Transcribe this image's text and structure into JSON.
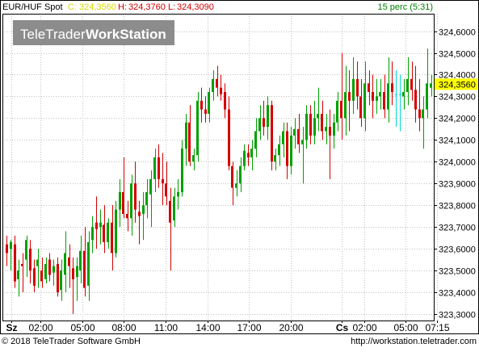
{
  "header": {
    "symbol": "EUR/HUF Spot",
    "close_label": "C:",
    "close_value": "324,3560",
    "high_label": "H:",
    "high_value": "324,3760",
    "low_label": "L:",
    "low_value": "324,3090",
    "interval": "15 perc (5:31)"
  },
  "watermark": {
    "brand_light": "TeleTrader",
    "brand_bold": "WorkStation"
  },
  "footer": {
    "copyright": "© 2018 TeleTrader Software GmbH",
    "url": "http://workstation.teletrader.com"
  },
  "colors": {
    "up": "#00a000",
    "down": "#d40000",
    "doji": "#00d8d8",
    "grid": "#c0c0c0",
    "price_tag": "#ffff00",
    "close_text": "#d8d800",
    "hl_text": "#d40000",
    "interval_text": "#008000"
  },
  "chart_data": {
    "type": "candlestick",
    "title": "EUR/HUF Spot",
    "ylim": [
      323.27,
      324.68
    ],
    "y_ticks": [
      "324,6000",
      "324,5000",
      "324,4000",
      "324,3000",
      "324,2000",
      "324,1000",
      "324,0000",
      "323,9000",
      "323,8000",
      "323,7000",
      "323,6000",
      "323,5000",
      "323,4000",
      "323,3000"
    ],
    "y_tick_values": [
      324.6,
      324.5,
      324.4,
      324.3,
      324.2,
      324.1,
      324.0,
      323.9,
      323.8,
      323.7,
      323.6,
      323.5,
      323.4,
      323.3
    ],
    "x_ticks": [
      {
        "label": "Sz",
        "bold": true,
        "slot": 1.6
      },
      {
        "label": "02:00",
        "bold": false,
        "slot": 9.2
      },
      {
        "label": "05:00",
        "bold": false,
        "slot": 19.9
      },
      {
        "label": "08:00",
        "bold": false,
        "slot": 30.6
      },
      {
        "label": "11:00",
        "bold": false,
        "slot": 41.3
      },
      {
        "label": "14:00",
        "bold": false,
        "slot": 52.0
      },
      {
        "label": "17:00",
        "bold": false,
        "slot": 62.7
      },
      {
        "label": "20:00",
        "bold": false,
        "slot": 73.4
      },
      {
        "label": "Cs",
        "bold": true,
        "slot": 86.5
      },
      {
        "label": "02:00",
        "bold": false,
        "slot": 92.3
      },
      {
        "label": "05:00",
        "bold": false,
        "slot": 103.0
      },
      {
        "label": "07:15",
        "bold": false,
        "slot": 111.0
      }
    ],
    "last_price": "324,3560",
    "last_value": 324.356,
    "candles": [
      [
        323.62,
        323.66,
        323.52,
        323.58
      ],
      [
        323.6,
        323.64,
        323.5,
        323.63
      ],
      [
        323.62,
        323.66,
        323.42,
        323.45
      ],
      [
        323.46,
        323.55,
        323.38,
        323.5
      ],
      [
        323.53,
        323.58,
        323.4,
        323.52
      ],
      [
        323.55,
        323.66,
        323.47,
        323.64
      ],
      [
        323.6,
        323.64,
        323.44,
        323.5
      ],
      [
        323.51,
        323.55,
        323.4,
        323.43
      ],
      [
        323.52,
        323.6,
        323.42,
        323.55
      ],
      [
        323.5,
        323.56,
        323.42,
        323.45
      ],
      [
        323.46,
        323.56,
        323.44,
        323.53
      ],
      [
        323.55,
        323.58,
        323.45,
        323.48
      ],
      [
        323.49,
        323.55,
        323.43,
        323.52
      ],
      [
        323.53,
        323.56,
        323.38,
        323.4
      ],
      [
        323.41,
        323.55,
        323.36,
        323.5
      ],
      [
        323.48,
        323.68,
        323.4,
        323.58
      ],
      [
        323.56,
        323.62,
        323.42,
        323.52
      ],
      [
        323.51,
        323.56,
        323.3,
        323.46
      ],
      [
        323.47,
        323.56,
        323.36,
        323.52
      ],
      [
        323.5,
        323.66,
        323.44,
        323.59
      ],
      [
        323.59,
        323.7,
        323.38,
        323.42
      ],
      [
        323.43,
        323.68,
        323.36,
        323.63
      ],
      [
        323.64,
        323.75,
        323.58,
        323.7
      ],
      [
        323.72,
        323.84,
        323.6,
        323.69
      ],
      [
        323.7,
        323.78,
        323.62,
        323.72
      ],
      [
        323.71,
        323.8,
        323.58,
        323.63
      ],
      [
        323.63,
        323.74,
        323.6,
        323.72
      ],
      [
        323.72,
        323.8,
        323.5,
        323.58
      ],
      [
        323.58,
        323.82,
        323.56,
        323.78
      ],
      [
        323.78,
        323.92,
        323.7,
        323.86
      ],
      [
        323.86,
        324.02,
        323.74,
        323.76
      ],
      [
        323.76,
        323.82,
        323.68,
        323.74
      ],
      [
        323.74,
        323.94,
        323.66,
        323.9
      ],
      [
        323.9,
        324.0,
        323.72,
        323.78
      ],
      [
        323.77,
        323.82,
        323.62,
        323.75
      ],
      [
        323.76,
        323.86,
        323.64,
        323.8
      ],
      [
        323.8,
        323.92,
        323.74,
        323.86
      ],
      [
        323.85,
        323.96,
        323.7,
        323.92
      ],
      [
        323.92,
        324.06,
        323.86,
        324.02
      ],
      [
        324.02,
        324.08,
        323.88,
        323.92
      ],
      [
        323.92,
        324.04,
        323.8,
        323.9
      ],
      [
        323.9,
        324.0,
        323.8,
        323.84
      ],
      [
        323.82,
        323.88,
        323.5,
        323.72
      ],
      [
        323.73,
        323.88,
        323.7,
        323.84
      ],
      [
        323.84,
        323.92,
        323.78,
        323.86
      ],
      [
        323.86,
        324.1,
        323.84,
        324.06
      ],
      [
        324.06,
        324.22,
        323.98,
        324.18
      ],
      [
        324.18,
        324.26,
        323.98,
        324.0
      ],
      [
        324.0,
        324.06,
        323.96,
        324.03
      ],
      [
        324.03,
        324.32,
        324.0,
        324.28
      ],
      [
        324.28,
        324.34,
        324.18,
        324.24
      ],
      [
        324.24,
        324.3,
        324.18,
        324.22
      ],
      [
        324.22,
        324.34,
        324.18,
        324.32
      ],
      [
        324.32,
        324.42,
        324.28,
        324.38
      ],
      [
        324.38,
        324.44,
        324.3,
        324.34
      ],
      [
        324.34,
        324.4,
        324.28,
        324.31
      ],
      [
        324.32,
        324.36,
        324.2,
        324.24
      ],
      [
        324.24,
        324.3,
        323.96,
        323.98
      ],
      [
        323.98,
        324.0,
        323.8,
        323.88
      ],
      [
        323.88,
        323.96,
        323.84,
        323.9
      ],
      [
        323.9,
        324.02,
        323.86,
        323.98
      ],
      [
        323.98,
        324.08,
        323.96,
        324.05
      ],
      [
        324.04,
        324.08,
        323.98,
        324.02
      ],
      [
        324.02,
        324.1,
        323.96,
        324.06
      ],
      [
        324.06,
        324.2,
        324.02,
        324.14
      ],
      [
        324.14,
        324.26,
        324.1,
        324.2
      ],
      [
        324.2,
        324.28,
        324.12,
        324.16
      ],
      [
        324.16,
        324.3,
        324.1,
        324.26
      ],
      [
        324.26,
        324.28,
        323.96,
        324.0
      ],
      [
        324.0,
        324.06,
        323.96,
        324.03
      ],
      [
        324.03,
        324.12,
        323.98,
        324.08
      ],
      [
        324.08,
        324.18,
        324.02,
        324.14
      ],
      [
        324.14,
        324.18,
        323.92,
        323.98
      ],
      [
        323.98,
        324.16,
        323.94,
        324.12
      ],
      [
        324.12,
        324.2,
        324.06,
        324.15
      ],
      [
        324.15,
        324.22,
        324.04,
        324.08
      ],
      [
        324.08,
        324.16,
        323.9,
        324.1
      ],
      [
        324.1,
        324.26,
        324.06,
        324.22
      ],
      [
        324.22,
        324.26,
        324.08,
        324.12
      ],
      [
        324.12,
        324.28,
        324.08,
        324.2
      ],
      [
        324.2,
        324.34,
        324.14,
        324.22
      ],
      [
        324.22,
        324.28,
        324.1,
        324.14
      ],
      [
        324.14,
        324.22,
        324.08,
        324.16
      ],
      [
        324.16,
        324.24,
        323.92,
        324.12
      ],
      [
        324.12,
        324.22,
        324.06,
        324.18
      ],
      [
        324.18,
        324.32,
        324.14,
        324.28
      ],
      [
        324.28,
        324.5,
        324.1,
        324.2
      ],
      [
        324.2,
        324.44,
        324.12,
        324.32
      ],
      [
        324.32,
        324.42,
        324.14,
        324.28
      ],
      [
        324.28,
        324.48,
        324.22,
        324.38
      ],
      [
        324.38,
        324.46,
        324.24,
        324.3
      ],
      [
        324.3,
        324.38,
        324.16,
        324.2
      ],
      [
        324.2,
        324.46,
        324.14,
        324.36
      ],
      [
        324.36,
        324.42,
        324.26,
        324.32
      ],
      [
        324.32,
        324.4,
        324.2,
        324.28
      ],
      [
        324.28,
        324.38,
        324.22,
        324.3
      ],
      [
        324.3,
        324.38,
        324.24,
        324.32
      ],
      [
        324.32,
        324.4,
        324.2,
        324.24
      ],
      [
        324.24,
        324.48,
        324.18,
        324.36
      ],
      [
        324.36,
        324.46,
        324.26,
        324.32
      ],
      [
        324.31,
        324.42,
        324.16,
        324.31
      ],
      [
        324.31,
        324.4,
        324.14,
        324.31
      ],
      [
        324.3,
        324.38,
        324.24,
        324.32
      ],
      [
        324.32,
        324.48,
        324.26,
        324.38
      ],
      [
        324.38,
        324.46,
        324.28,
        324.33
      ],
      [
        324.33,
        324.44,
        324.18,
        324.24
      ],
      [
        324.24,
        324.38,
        324.14,
        324.2
      ],
      [
        324.2,
        324.3,
        324.06,
        324.24
      ],
      [
        324.24,
        324.52,
        324.2,
        324.36
      ],
      [
        324.34,
        324.4,
        324.3,
        324.36
      ]
    ]
  }
}
